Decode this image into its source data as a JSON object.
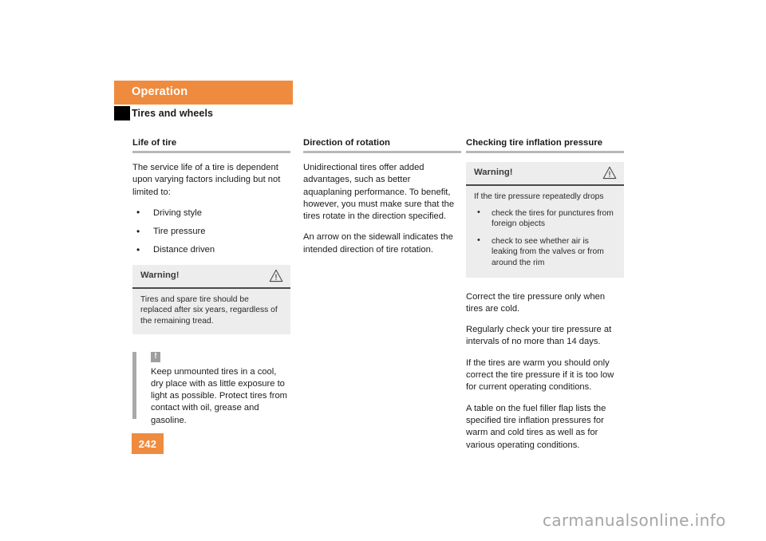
{
  "header": {
    "section_label": "Operation",
    "page_subtitle": "Tires and wheels",
    "accent_color": "#ef8b3f",
    "tab_color": "#000000"
  },
  "columns": {
    "left": {
      "heading": "Life of tire",
      "intro": "The service life of a tire is dependent upon varying factors including but not limited to:",
      "bullets": [
        "Driving style",
        "Tire pressure",
        "Distance driven"
      ],
      "warning": {
        "title": "Warning!",
        "icon": "warning-triangle-icon",
        "body": "Tires and spare tire should be replaced after six years, regardless of the remaining tread."
      },
      "note": {
        "icon": "exclamation-mark-icon",
        "body": "Keep unmounted tires in a cool, dry place with as little exposure to light as possible. Protect tires from contact with oil, grease and gasoline."
      }
    },
    "middle": {
      "heading": "Direction of rotation",
      "paragraphs": [
        "Unidirectional tires offer added advantages, such as better aquaplaning performance. To benefit, however, you must make sure that the tires rotate in the direction specified.",
        "An arrow on the sidewall indicates the intended direction of tire rotation."
      ]
    },
    "right": {
      "heading": "Checking tire inflation pressure",
      "warning": {
        "title": "Warning!",
        "icon": "warning-triangle-icon",
        "intro": "If the tire pressure repeatedly drops",
        "bullets": [
          "check the tires for punctures from foreign objects",
          "check to see whether air is leaking from the valves or from around the rim"
        ]
      },
      "paragraphs": [
        "Correct the tire pressure only when tires are cold.",
        "Regularly check your tire pressure at intervals of no more than 14 days.",
        "If the tires are warm you should only correct the tire pressure if it is too low for current operating conditions.",
        "A table on the fuel filler flap lists the specified tire inflation pressures for warm and cold tires as well as for various operating conditions."
      ]
    }
  },
  "footer": {
    "page_number": "242",
    "watermark": "carmanualsonline.info"
  }
}
